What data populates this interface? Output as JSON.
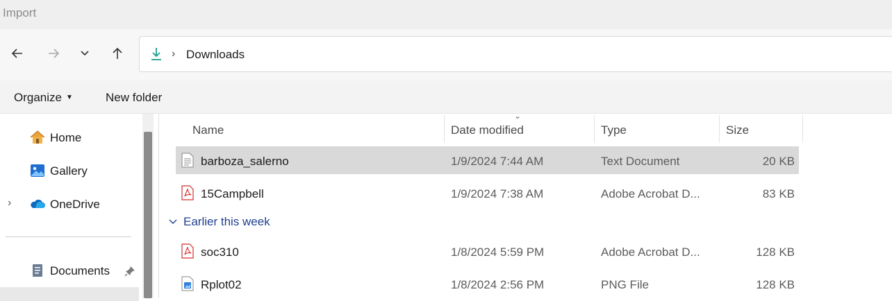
{
  "window": {
    "title": "Import"
  },
  "navigation": {
    "back_icon": "arrow-left-icon",
    "forward_icon": "arrow-right-icon",
    "recent_icon": "chevron-down-icon",
    "up_icon": "arrow-up-icon"
  },
  "address_bar": {
    "location_icon": "download-icon",
    "separator": "›",
    "crumb": "Downloads"
  },
  "toolbar": {
    "organize_label": "Organize",
    "new_folder_label": "New folder"
  },
  "sidebar": {
    "items": [
      {
        "label": "Home",
        "icon": "home-icon"
      },
      {
        "label": "Gallery",
        "icon": "gallery-icon"
      },
      {
        "label": "OneDrive",
        "icon": "onedrive-cloud-icon"
      },
      {
        "label": "Documents",
        "icon": "documents-icon"
      }
    ],
    "expand_glyph": "›"
  },
  "file_list": {
    "columns": {
      "name": "Name",
      "date": "Date modified",
      "type": "Type",
      "size": "Size"
    },
    "rows_today": [
      {
        "name": "barboza_salerno",
        "date": "1/9/2024 7:44 AM",
        "type": "Text Document",
        "size": "20 KB",
        "icon": "text-file-icon",
        "selected": true
      },
      {
        "name": "15Campbell",
        "date": "1/9/2024 7:38 AM",
        "type": "Adobe Acrobat D...",
        "size": "83 KB",
        "icon": "pdf-file-icon"
      }
    ],
    "group_label": "Earlier this week",
    "rows_earlier": [
      {
        "name": "soc310",
        "date": "1/8/2024 5:59 PM",
        "type": "Adobe Acrobat D...",
        "size": "128 KB",
        "icon": "pdf-file-icon"
      },
      {
        "name": "Rplot02",
        "date": "1/8/2024 2:56 PM",
        "type": "PNG File",
        "size": "128 KB",
        "icon": "png-file-icon"
      }
    ]
  },
  "colors": {
    "accent": "#1a73e8",
    "group_header": "#1f3f8f",
    "selection": "#d9d9d9",
    "pdf_red": "#d32f2f",
    "download_teal": "#1a9e8f"
  }
}
